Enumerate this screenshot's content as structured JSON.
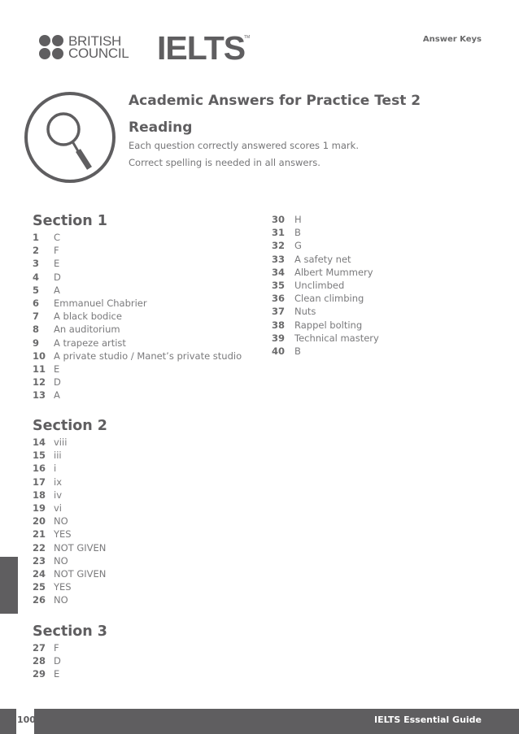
{
  "header": {
    "british_council_line1": "BRITISH",
    "british_council_line2": "COUNCIL",
    "ielts_logo": "IELTS",
    "trademark": "TM",
    "answer_keys": "Answer Keys"
  },
  "intro": {
    "icon": "magnifying-glass-icon",
    "title": "Academic Answers for Practice Test 2",
    "subtitle": "Reading",
    "note1": "Each question correctly answered scores 1 mark.",
    "note2": "Correct spelling is needed in all answers."
  },
  "sections": [
    {
      "title": "Section 1",
      "answers": [
        {
          "n": "1",
          "a": "C"
        },
        {
          "n": "2",
          "a": "F"
        },
        {
          "n": "3",
          "a": "E"
        },
        {
          "n": "4",
          "a": "D"
        },
        {
          "n": "5",
          "a": "A"
        },
        {
          "n": "6",
          "a": "Emmanuel Chabrier"
        },
        {
          "n": "7",
          "a": "A black bodice"
        },
        {
          "n": "8",
          "a": "An auditorium"
        },
        {
          "n": "9",
          "a": "A trapeze artist"
        },
        {
          "n": "10",
          "a": "A private studio / Manet’s private studio"
        },
        {
          "n": "11",
          "a": "E"
        },
        {
          "n": "12",
          "a": "D"
        },
        {
          "n": "13",
          "a": "A"
        }
      ]
    },
    {
      "title": "Section 2",
      "answers": [
        {
          "n": "14",
          "a": "viii"
        },
        {
          "n": "15",
          "a": "iii"
        },
        {
          "n": "16",
          "a": "i"
        },
        {
          "n": "17",
          "a": "ix"
        },
        {
          "n": "18",
          "a": "iv"
        },
        {
          "n": "19",
          "a": "vi"
        },
        {
          "n": "20",
          "a": "NO"
        },
        {
          "n": "21",
          "a": "YES"
        },
        {
          "n": "22",
          "a": "NOT GIVEN"
        },
        {
          "n": "23",
          "a": "NO"
        },
        {
          "n": "24",
          "a": "NOT GIVEN"
        },
        {
          "n": "25",
          "a": "YES"
        },
        {
          "n": "26",
          "a": "NO"
        }
      ]
    },
    {
      "title": "Section 3",
      "answers": [
        {
          "n": "27",
          "a": "F"
        },
        {
          "n": "28",
          "a": "D"
        },
        {
          "n": "29",
          "a": "E"
        },
        {
          "n": "30",
          "a": "H"
        },
        {
          "n": "31",
          "a": "B"
        },
        {
          "n": "32",
          "a": "G"
        },
        {
          "n": "33",
          "a": "A safety net"
        },
        {
          "n": "34",
          "a": "Albert Mummery"
        },
        {
          "n": "35",
          "a": "Unclimbed"
        },
        {
          "n": "36",
          "a": "Clean climbing"
        },
        {
          "n": "37",
          "a": "Nuts"
        },
        {
          "n": "38",
          "a": "Rappel bolting"
        },
        {
          "n": "39",
          "a": "Technical mastery"
        },
        {
          "n": "40",
          "a": "B"
        }
      ]
    }
  ],
  "footer": {
    "page_number": "100",
    "guide_title": "IELTS Essential Guide"
  }
}
